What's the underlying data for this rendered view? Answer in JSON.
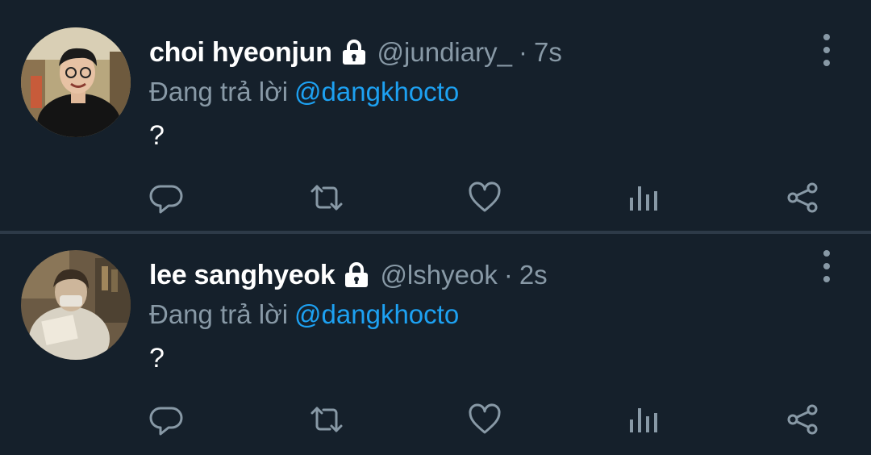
{
  "tweets": [
    {
      "display_name": "choi hyeonjun",
      "handle": "@jundiary_",
      "separator": "·",
      "time": "7s",
      "reply_prefix": "Đang trả lời",
      "reply_to": "@dangkhocto",
      "text": "?"
    },
    {
      "display_name": "lee sanghyeok",
      "handle": "@lshyeok",
      "separator": "·",
      "time": "2s",
      "reply_prefix": "Đang trả lời",
      "reply_to": "@dangkhocto",
      "text": "?"
    }
  ],
  "icons": {
    "lock": "lock-icon",
    "more": "more-vertical-icon",
    "reply": "reply-icon",
    "retweet": "retweet-icon",
    "like": "heart-icon",
    "analytics": "analytics-icon",
    "share": "share-icon"
  },
  "colors": {
    "background": "#15202b",
    "text_primary": "#ffffff",
    "text_secondary": "#8899a6",
    "accent": "#1da1f2",
    "divider": "#2d3a48"
  }
}
